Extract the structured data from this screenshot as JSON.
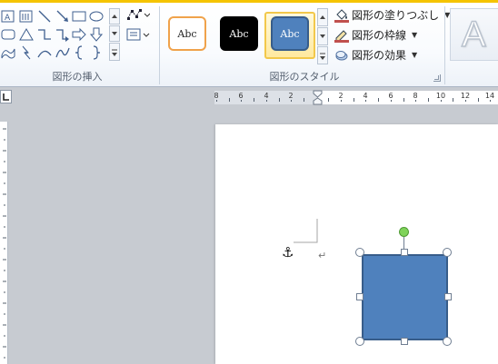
{
  "ribbon": {
    "groups": {
      "insert_shapes_label": "図形の挿入",
      "shape_styles_label": "図形のスタイル"
    },
    "styles": [
      {
        "label": "Abc",
        "bg": "#ffffff",
        "border": "#f0a24b",
        "color": "#222222"
      },
      {
        "label": "Abc",
        "bg": "#000000",
        "border": "#000000",
        "color": "#ffffff"
      },
      {
        "label": "Abc",
        "bg": "#4f81bd",
        "border": "#385d8a",
        "color": "#ffffff"
      }
    ],
    "commands": {
      "fill": "図形の塗りつぶし",
      "outline": "図形の枠線",
      "effects": "図形の効果"
    },
    "wordart_letter": "A"
  },
  "ruler": {
    "numbers": [
      "8",
      "6",
      "4",
      "2",
      "2",
      "4",
      "6",
      "8",
      "10",
      "12",
      "14"
    ]
  },
  "document": {
    "anchor_glyph": "⚓",
    "paragraph_mark": "↵",
    "shape": {
      "fill": "#4f81bd",
      "border": "#385d8a",
      "rotate_handle": "#7fd35a"
    }
  },
  "colors": {
    "accent_tab": "#f5c400",
    "selected_style_border": "#f2c84b"
  }
}
